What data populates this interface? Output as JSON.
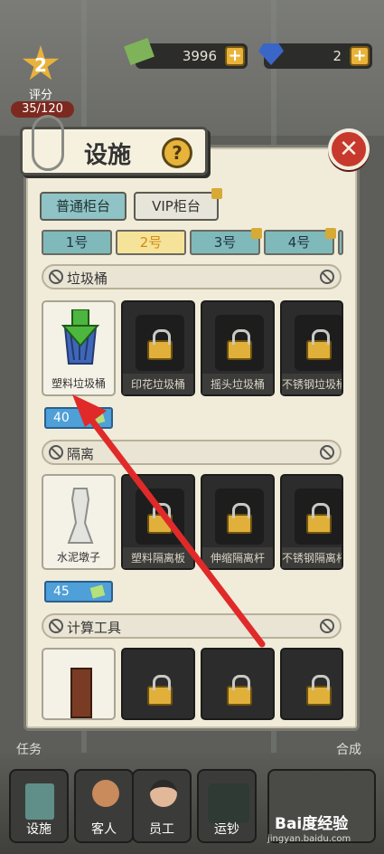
{
  "hud": {
    "rating_value": "2",
    "rating_label": "评分",
    "rating_progress": "35/120",
    "cash": "3996",
    "gems": "2"
  },
  "panel": {
    "title": "设施",
    "help": "?",
    "close": "✕",
    "tabs": [
      {
        "label": "普通柜台",
        "active": true
      },
      {
        "label": "VIP柜台",
        "active": false,
        "locked": true
      }
    ],
    "counters": [
      {
        "label": "1号",
        "active": false
      },
      {
        "label": "2号",
        "active": true
      },
      {
        "label": "3号",
        "active": false,
        "locked": true
      },
      {
        "label": "4号",
        "active": false,
        "locked": true
      }
    ],
    "sections": [
      {
        "name": "垃圾桶",
        "items": [
          {
            "label": "塑料垃圾桶",
            "owned": true
          },
          {
            "label": "印花垃圾桶",
            "owned": false
          },
          {
            "label": "摇头垃圾桶",
            "owned": false
          },
          {
            "label": "不锈钢垃圾桶",
            "owned": false
          }
        ],
        "price": "40"
      },
      {
        "name": "隔离",
        "items": [
          {
            "label": "水泥墩子",
            "owned": true
          },
          {
            "label": "塑料隔离板",
            "owned": false
          },
          {
            "label": "伸缩隔离杆",
            "owned": false
          },
          {
            "label": "不锈钢隔离杆",
            "owned": false
          }
        ],
        "price": "45"
      },
      {
        "name": "计算工具",
        "items": [
          {
            "label": "",
            "owned": true
          },
          {
            "label": "",
            "owned": false
          },
          {
            "label": "",
            "owned": false
          },
          {
            "label": "",
            "owned": false
          }
        ]
      }
    ]
  },
  "bottom_nav": [
    {
      "label": "设施"
    },
    {
      "label": "客人"
    },
    {
      "label": "员工"
    },
    {
      "label": "运钞"
    }
  ],
  "side_labels": {
    "left": "任务",
    "right": "合成"
  },
  "watermark": {
    "brand": "Bai度经验",
    "url": "jingyan.baidu.com"
  },
  "colors": {
    "accent": "#e9b33a",
    "close": "#c7392c",
    "arrow": "#e02a2a",
    "price": "#4f9fd8"
  }
}
